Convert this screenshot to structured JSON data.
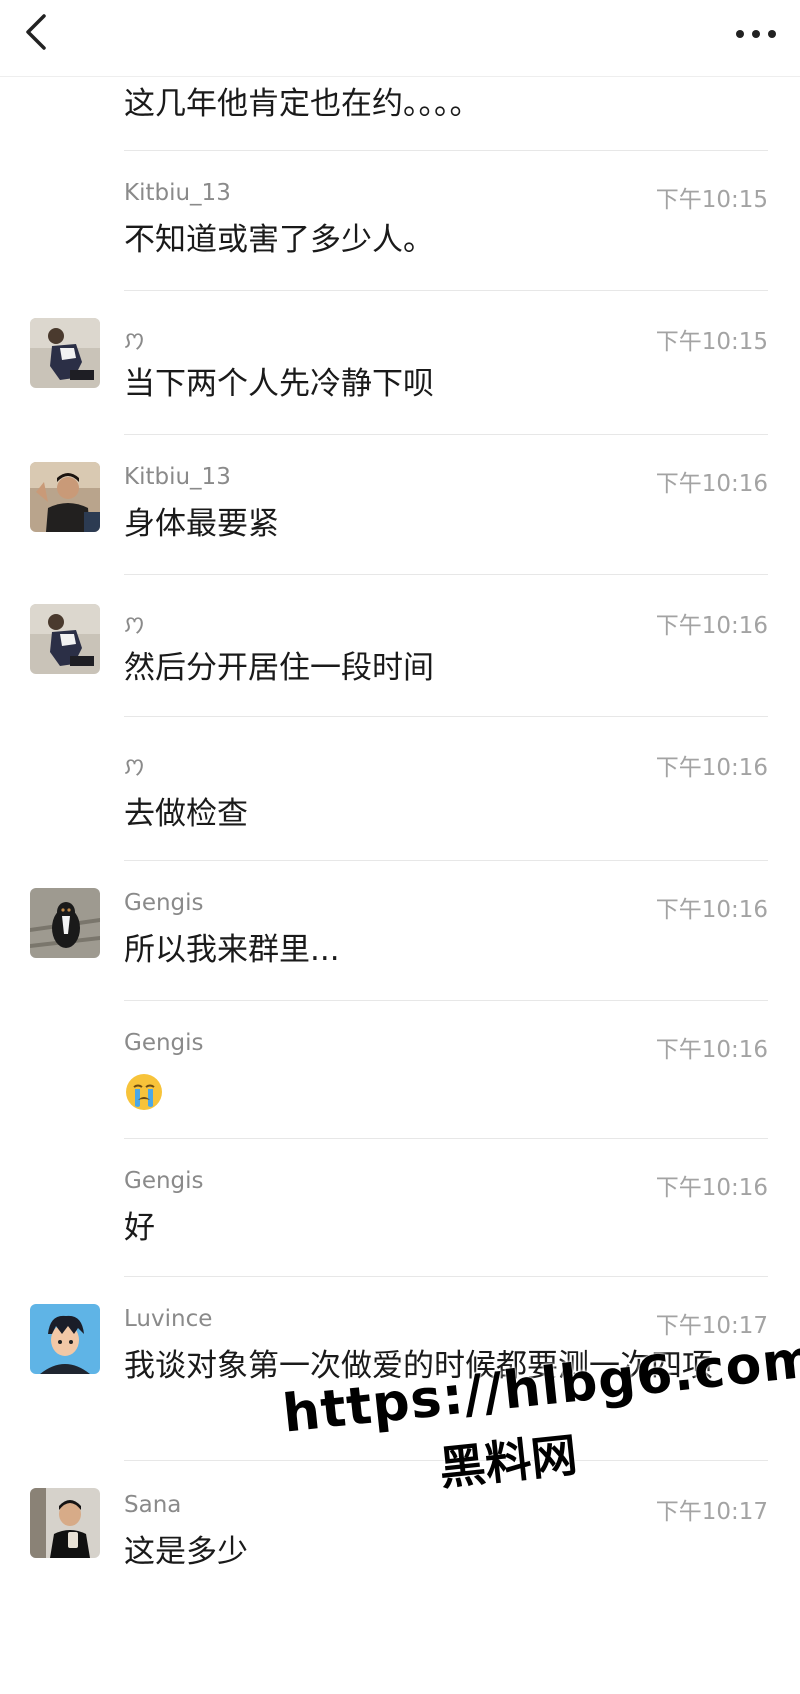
{
  "header": {
    "back_icon": "chevron-left-icon",
    "more_icon": "more-dots-icon"
  },
  "messages": [
    {
      "sender": "",
      "time": "",
      "text": "这几年他肯定也在约。。。。",
      "avatar": "none"
    },
    {
      "sender": "Kitbiu_13",
      "time": "下午10:15",
      "text": "不知道或害了多少人。",
      "avatar": "none"
    },
    {
      "sender": "ꩀ",
      "time": "下午10:15",
      "text": "当下两个人先冷静下呗",
      "avatar": "person-kneeling-photo"
    },
    {
      "sender": "Kitbiu_13",
      "time": "下午10:16",
      "text": "身体最要紧",
      "avatar": "person-selfie-photo"
    },
    {
      "sender": "ꩀ",
      "time": "下午10:16",
      "text": "然后分开居住一段时间",
      "avatar": "person-kneeling-photo"
    },
    {
      "sender": "ꩀ",
      "time": "下午10:16",
      "text": "去做检查",
      "avatar": "none"
    },
    {
      "sender": "Gengis",
      "time": "下午10:16",
      "text": "所以我来群里...",
      "avatar": "dog-photo"
    },
    {
      "sender": "Gengis",
      "time": "下午10:16",
      "text": "",
      "emoji": "crying-face-emoji",
      "avatar": "none"
    },
    {
      "sender": "Gengis",
      "time": "下午10:16",
      "text": "好",
      "avatar": "none"
    },
    {
      "sender": "Luvince",
      "time": "下午10:17",
      "text": "我谈对象第一次做爱的时候都要测一次四项",
      "avatar": "anime-boy-avatar"
    },
    {
      "sender": "Sana",
      "time": "下午10:17",
      "text": "这是多少",
      "avatar": "mirror-selfie-photo"
    }
  ],
  "watermark": {
    "url": "https://hlbg6.com",
    "name": "黑料网"
  }
}
